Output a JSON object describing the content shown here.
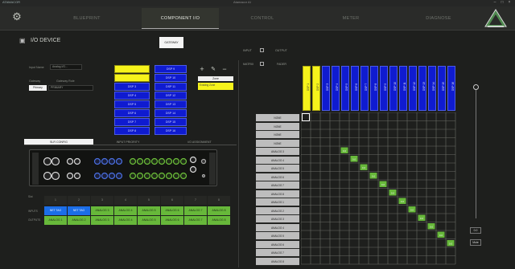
{
  "titlebar": {
    "brand": "ATAMACOR",
    "title": "Atamacor AI"
  },
  "nav": {
    "tabs": [
      {
        "label": "BLUEPRINT",
        "active": false
      },
      {
        "label": "COMPONENT I/O",
        "active": true
      },
      {
        "label": "CONTROL",
        "active": false
      },
      {
        "label": "METER",
        "active": false
      },
      {
        "label": "DIAGNOSE",
        "active": false
      }
    ]
  },
  "page": {
    "title": "I/O DEVICE",
    "gateway_label": "GATEWAY"
  },
  "device_form": {
    "input_name_label": "Input Name",
    "input_name_value": "Analog I/O...",
    "gateway_label": "Gateway",
    "gateway_role_label": "Gateway Role",
    "gateway_value": "Primary",
    "gateway_role_value": "PRIMARY"
  },
  "dsp_list": [
    "DSP 9",
    "DSP 10",
    "DSP 11",
    "DSP 12",
    "DSP 13",
    "DSP 14",
    "DSP 15",
    "DSP 16"
  ],
  "dsp_left": [
    "DSP 3",
    "DSP 4",
    "DSP 5",
    "DSP 6",
    "DSP 7",
    "DSP 8"
  ],
  "zone": {
    "header": "Zone",
    "item": "Existing Zone"
  },
  "io_toggle": {
    "input": "INPUT",
    "output": "OUTPUT",
    "matrix": "MATRIX",
    "fader": "FADER"
  },
  "bottom_tabs": [
    "SLR CONFIG",
    "INPUT PRIORITY",
    "I/O ASSIGNMENT"
  ],
  "channel_table": {
    "row_labels": [
      "INPUTS",
      "OUTPUTS"
    ],
    "header_row_label": "Slot",
    "columns": [
      "1",
      "2",
      "3",
      "4",
      "5",
      "6",
      "7",
      "8"
    ],
    "inputs": [
      "NET TAG",
      "NET TAG",
      "ANALOG 3",
      "ANALOG 4",
      "ANALOG 5",
      "ANALOG 6",
      "ANALOG 7",
      "ANALOG 8"
    ],
    "outputs": [
      "ANALOG 1",
      "ANALOG 2",
      "ANALOG 3",
      "ANALOG 4",
      "ANALOG 5",
      "ANALOG 6",
      "ANALOG 7",
      "ANALOG 8"
    ]
  },
  "matrix": {
    "columns": [
      "DSP 1",
      "DSP 2",
      "DSP 3",
      "DSP 4",
      "DSP 5",
      "DSP 6",
      "DSP 7",
      "DSP 8",
      "DSP 9",
      "DSP 10",
      "DSP 11",
      "DSP 12",
      "DSP 13",
      "DSP 14",
      "DSP 15",
      "DSP 16"
    ],
    "rows": [
      "NONE",
      "NONE",
      "NONE",
      "NONE",
      "ANALOG 3",
      "ANALOG 4",
      "ANALOG 5",
      "ANALOG 6",
      "ANALOG 7",
      "ANALOG 8",
      "ANALOG 1",
      "ANALOG 2",
      "ANALOG 3",
      "ANALOG 4",
      "ANALOG 5",
      "ANALOG 6",
      "ANALOG 7",
      "ANALOG 8"
    ],
    "on_label": "0.0"
  },
  "fader": {
    "value": "0.0",
    "mute": "Mute"
  },
  "colors": {
    "dsp_blue": "#0f1bd0",
    "yellow": "#f6f31b",
    "green": "#67b83a",
    "bg": "#1e1f1d"
  }
}
